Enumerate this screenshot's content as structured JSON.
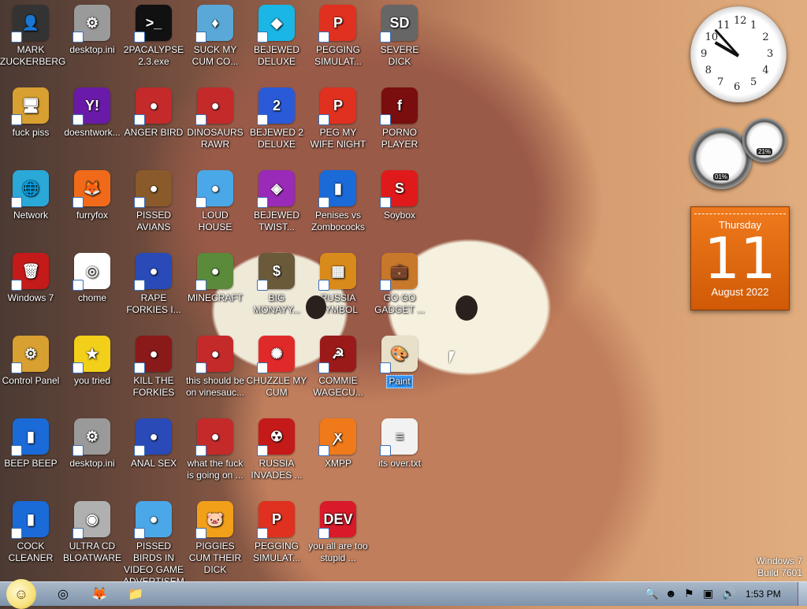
{
  "colors": {
    "taskbar": "#8ea3ba",
    "selection": "#3399ff",
    "calendar": "#e8690f"
  },
  "desktop_icons": [
    {
      "name": "MARK ZUCKERBERG",
      "icon": "person-icon",
      "bg": "#333333",
      "glyph": "👤"
    },
    {
      "name": "desktop.ini",
      "icon": "settings-file-icon",
      "bg": "#9a9a9a",
      "glyph": "⚙"
    },
    {
      "name": "2PACALYPSE 2.3.exe",
      "icon": "console-icon",
      "bg": "#111111",
      "glyph": ">_"
    },
    {
      "name": "SUCK MY CUM CO...",
      "icon": "game-icon",
      "bg": "#5aa8d8",
      "glyph": "♦"
    },
    {
      "name": "BEJEWED DELUXE",
      "icon": "gem-icon",
      "bg": "#1ab6e6",
      "glyph": "◆"
    },
    {
      "name": "PEGGING SIMULAT...",
      "icon": "p-icon",
      "bg": "#e03020",
      "glyph": "P"
    },
    {
      "name": "SEVERE DICK",
      "icon": "sd-gear-icon",
      "bg": "#666666",
      "glyph": "SD"
    },
    {
      "name": "fuck piss",
      "icon": "computer-icon",
      "bg": "#d8a030",
      "glyph": "🖥"
    },
    {
      "name": "doesntwork...",
      "icon": "yahoo-icon",
      "bg": "#6a1aa8",
      "glyph": "Y!"
    },
    {
      "name": "ANGER BIRD",
      "icon": "angry-bird-icon",
      "bg": "#c42a2a",
      "glyph": "●"
    },
    {
      "name": "DINOSAURS RAWR",
      "icon": "angry-bird-icon",
      "bg": "#c42a2a",
      "glyph": "●"
    },
    {
      "name": "BEJEWED 2 DELUXE",
      "icon": "gem-icon",
      "bg": "#2a5ad8",
      "glyph": "2"
    },
    {
      "name": "PEG MY WIFE NIGHT",
      "icon": "p-icon",
      "bg": "#e03020",
      "glyph": "P"
    },
    {
      "name": "PORNO PLAYER",
      "icon": "flash-icon",
      "bg": "#7a0d0d",
      "glyph": "f"
    },
    {
      "name": "Network",
      "icon": "network-globe-icon",
      "bg": "#2aa8d8",
      "glyph": "🌐"
    },
    {
      "name": "furryfox",
      "icon": "firefox-icon",
      "bg": "#f06a1a",
      "glyph": "🦊"
    },
    {
      "name": "PISSED AVIANS",
      "icon": "angry-bird-icon",
      "bg": "#8a5a2a",
      "glyph": "●"
    },
    {
      "name": "LOUD HOUSE",
      "icon": "angry-bird-icon",
      "bg": "#4aa8e8",
      "glyph": "●"
    },
    {
      "name": "BEJEWED TWIST...",
      "icon": "gem-icon",
      "bg": "#9a2ab8",
      "glyph": "◈"
    },
    {
      "name": "Penises vs Zombococks",
      "icon": "app-icon",
      "bg": "#1a6ad8",
      "glyph": "▮"
    },
    {
      "name": "Soybox",
      "icon": "s-icon",
      "bg": "#e01a1a",
      "glyph": "S"
    },
    {
      "name": "Windows 7",
      "icon": "recycle-bin-icon",
      "bg": "#c41a1a",
      "glyph": "🗑"
    },
    {
      "name": "chome",
      "icon": "chrome-icon",
      "bg": "#ffffff",
      "glyph": "◎"
    },
    {
      "name": "RAPE FORKIES I...",
      "icon": "angry-bird-icon",
      "bg": "#2a4ab8",
      "glyph": "●"
    },
    {
      "name": "MINECRAFT",
      "icon": "angry-bird-icon",
      "bg": "#5a8a3a",
      "glyph": "●"
    },
    {
      "name": "BIG MONAYY...",
      "icon": "money-bag-icon",
      "bg": "#6a5a3a",
      "glyph": "$"
    },
    {
      "name": "RUSSIA SYMBOL",
      "icon": "blocks-icon",
      "bg": "#d88a1a",
      "glyph": "▦"
    },
    {
      "name": "GO GO GADGET ...",
      "icon": "briefcase-icon",
      "bg": "#c8782a",
      "glyph": "💼"
    },
    {
      "name": "Control Panel",
      "icon": "control-panel-icon",
      "bg": "#d8a030",
      "glyph": "⚙"
    },
    {
      "name": "you tried",
      "icon": "star-icon",
      "bg": "#f2d01a",
      "glyph": "★"
    },
    {
      "name": "KILL THE FORKIES",
      "icon": "angry-bird-icon",
      "bg": "#8a1a1a",
      "glyph": "●"
    },
    {
      "name": "this should be on vinesauc...",
      "icon": "angry-bird-icon",
      "bg": "#c42a2a",
      "glyph": "●"
    },
    {
      "name": "CHUZZLE MY CUM",
      "icon": "chuzzle-icon",
      "bg": "#e02a2a",
      "glyph": "✺"
    },
    {
      "name": "COMMIE WAGECU...",
      "icon": "emblem-icon",
      "bg": "#9a1a1a",
      "glyph": "☭"
    },
    {
      "name": "Paint",
      "icon": "paint-palette-icon",
      "bg": "#e8e0c8",
      "glyph": "🎨",
      "selected": true
    },
    {
      "name": "BEEP BEEP",
      "icon": "app-icon",
      "bg": "#1a6ad8",
      "glyph": "▮"
    },
    {
      "name": "desktop.ini",
      "icon": "settings-file-icon",
      "bg": "#9a9a9a",
      "glyph": "⚙"
    },
    {
      "name": "ANAL SEX",
      "icon": "angry-bird-icon",
      "bg": "#2a4ab8",
      "glyph": "●"
    },
    {
      "name": "what the fuck is going on ...",
      "icon": "angry-bird-icon",
      "bg": "#c42a2a",
      "glyph": "●"
    },
    {
      "name": "RUSSIA INVADES ...",
      "icon": "radiation-icon",
      "bg": "#c41a1a",
      "glyph": "☢"
    },
    {
      "name": "XMPP",
      "icon": "xampp-icon",
      "bg": "#f07a1a",
      "glyph": "ꭗ"
    },
    {
      "name": "its over.txt",
      "icon": "text-file-icon",
      "bg": "#f2f2f2",
      "glyph": "≡"
    },
    {
      "name": "COCK CLEANER",
      "icon": "app-icon",
      "bg": "#1a6ad8",
      "glyph": "▮"
    },
    {
      "name": "ULTRA CD BLOATWARE",
      "icon": "cd-icon",
      "bg": "#b0b0b0",
      "glyph": "◉"
    },
    {
      "name": "PISSED BIRDS IN VIDEO GAME ADVERTISEM...",
      "icon": "angry-bird-icon",
      "bg": "#4aa8e8",
      "glyph": "●"
    },
    {
      "name": "PIGGIES CUM THEIR DICK",
      "icon": "pig-icon",
      "bg": "#f2a01a",
      "glyph": "🐷"
    },
    {
      "name": "PEGGING SIMULAT...",
      "icon": "p-icon",
      "bg": "#e03020",
      "glyph": "P"
    },
    {
      "name": "you all are too stupid ...",
      "icon": "devcpp-icon",
      "bg": "#d81a2a",
      "glyph": "DEV"
    }
  ],
  "gadgets": {
    "clock": {
      "numbers": [
        "12",
        "1",
        "2",
        "3",
        "4",
        "5",
        "6",
        "7",
        "8",
        "9",
        "10",
        "11"
      ]
    },
    "meters": {
      "cpu": "01%",
      "memory": "21%"
    },
    "calendar": {
      "weekday": "Thursday",
      "day": "11",
      "month_year": "August 2022"
    }
  },
  "watermark": {
    "line1": "Windows 7",
    "line2": "Build 7601"
  },
  "taskbar": {
    "start_icon": "start-orb-icon",
    "pinned": [
      {
        "name": "chrome",
        "icon": "chrome-icon",
        "glyph": "◎"
      },
      {
        "name": "firefox",
        "icon": "firefox-icon",
        "glyph": "🦊"
      },
      {
        "name": "explorer",
        "icon": "folder-icon",
        "glyph": "📁"
      }
    ],
    "time": "1:53 PM"
  }
}
